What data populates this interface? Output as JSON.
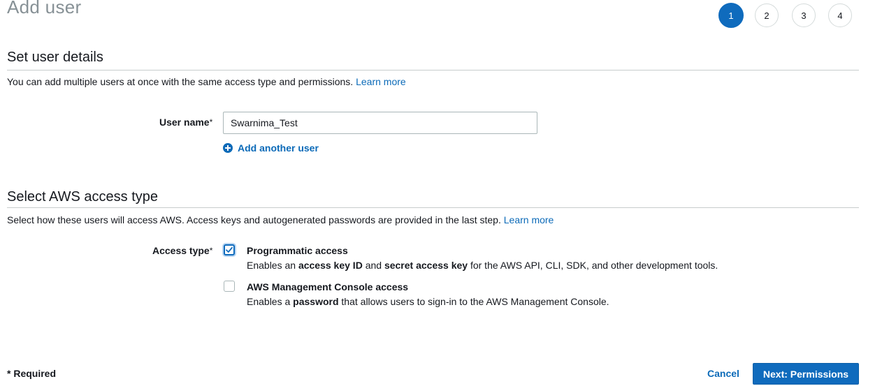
{
  "page": {
    "title": "Add user"
  },
  "steps": [
    {
      "label": "1",
      "active": true
    },
    {
      "label": "2",
      "active": false
    },
    {
      "label": "3",
      "active": false
    },
    {
      "label": "4",
      "active": false
    }
  ],
  "user_details": {
    "title": "Set user details",
    "description": "You can add multiple users at once with the same access type and permissions.",
    "learn_more": "Learn more",
    "username_label": "User name",
    "required_mark": "*",
    "username_value": "Swarnima_Test",
    "add_another": "Add another user"
  },
  "access": {
    "title": "Select AWS access type",
    "description": "Select how these users will access AWS. Access keys and autogenerated passwords are provided in the last step.",
    "learn_more": "Learn more",
    "access_type_label": "Access type",
    "required_mark": "*",
    "options": [
      {
        "title": "Programmatic access",
        "checked": true,
        "desc_pre": "Enables an ",
        "desc_b1": "access key ID",
        "desc_mid": " and ",
        "desc_b2": "secret access key",
        "desc_post": " for the AWS API, CLI, SDK, and other development tools."
      },
      {
        "title": "AWS Management Console access",
        "checked": false,
        "desc_pre": "Enables a ",
        "desc_b1": "password",
        "desc_post": " that allows users to sign-in to the AWS Management Console."
      }
    ]
  },
  "footer": {
    "required_note": "* Required",
    "cancel": "Cancel",
    "next": "Next: Permissions"
  },
  "colors": {
    "primary": "#0f6bbd",
    "link": "#0b6ab8",
    "title_gray": "#879196"
  }
}
